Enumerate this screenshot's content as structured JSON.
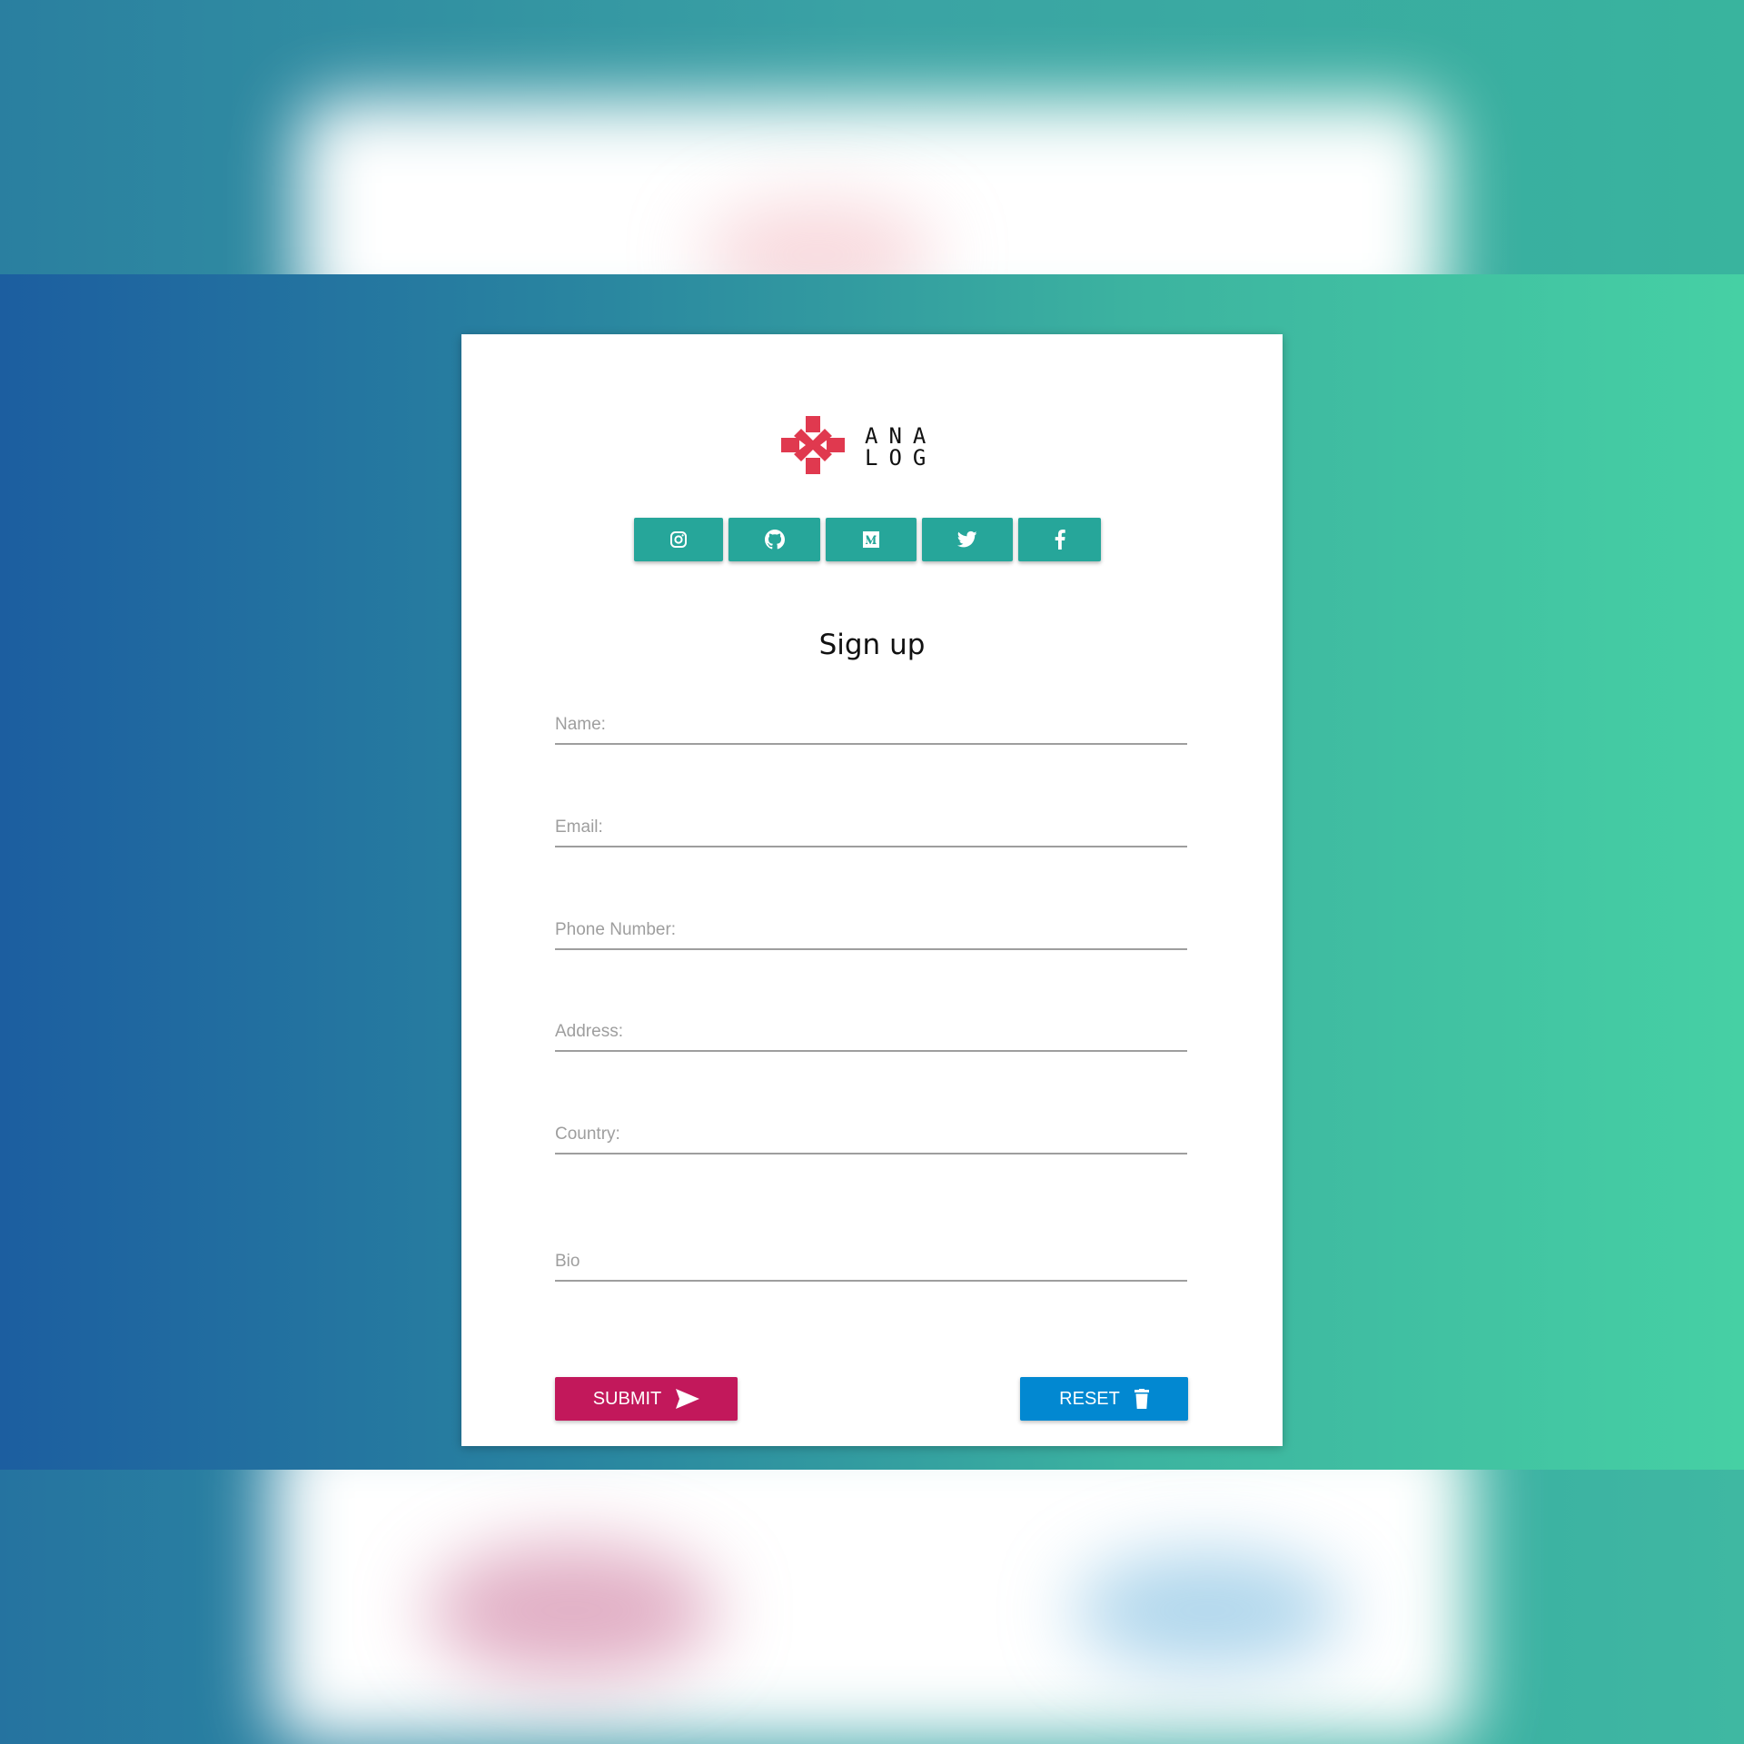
{
  "brand": {
    "logo_line1": "ANA",
    "logo_line2": "LOG",
    "logo_accent": "#e0394f"
  },
  "social_links": [
    {
      "icon": "instagram-icon"
    },
    {
      "icon": "github-icon"
    },
    {
      "icon": "medium-icon"
    },
    {
      "icon": "twitter-icon"
    },
    {
      "icon": "facebook-icon"
    }
  ],
  "form": {
    "title": "Sign up",
    "fields": {
      "name": {
        "placeholder": "Name:",
        "value": ""
      },
      "email": {
        "placeholder": "Email:",
        "value": ""
      },
      "phone": {
        "placeholder": "Phone Number:",
        "value": ""
      },
      "address": {
        "placeholder": "Address:",
        "value": ""
      },
      "country": {
        "placeholder": "Country:",
        "value": ""
      },
      "bio": {
        "placeholder": "Bio",
        "value": ""
      }
    },
    "submit_label": "SUBMIT",
    "reset_label": "RESET"
  },
  "colors": {
    "social_button": "#26a69a",
    "submit_button": "#c2185b",
    "reset_button": "#0288d1",
    "background_start": "#1c5ea0",
    "background_end": "#46d0a4"
  }
}
